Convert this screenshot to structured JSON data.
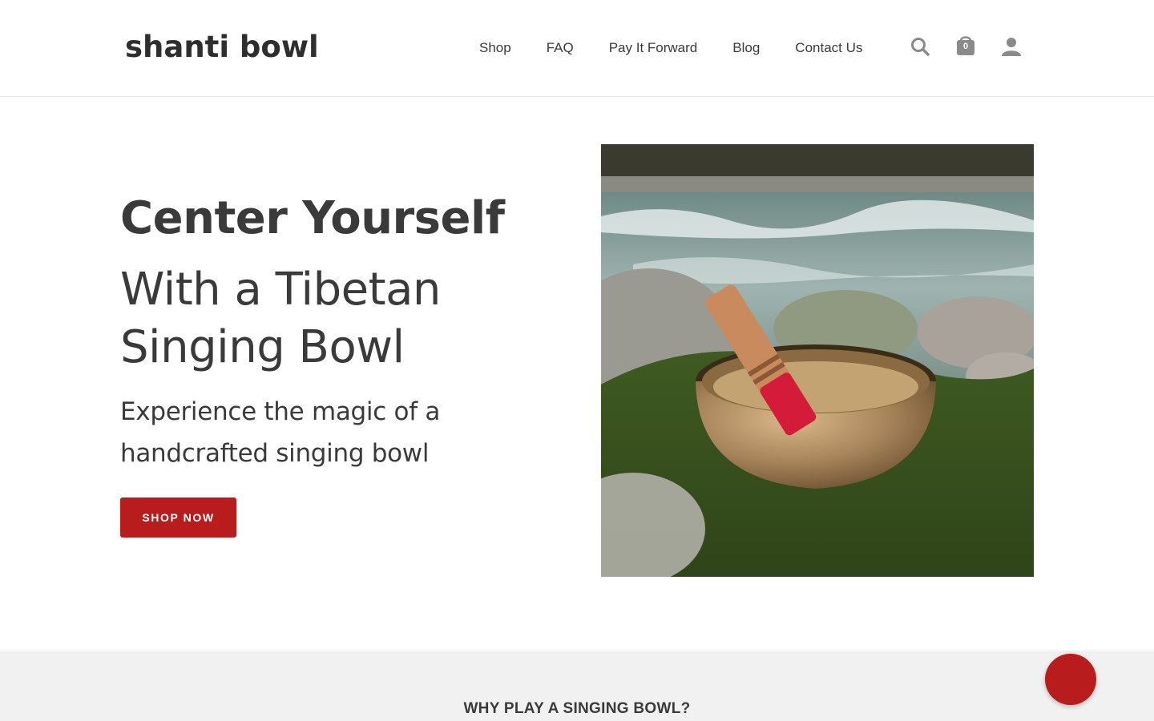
{
  "header": {
    "logo": "shanti bowl",
    "nav": [
      "Shop",
      "FAQ",
      "Pay It Forward",
      "Blog",
      "Contact Us"
    ],
    "cart_count": "0",
    "icons": [
      "search-icon",
      "cart-icon",
      "user-icon"
    ]
  },
  "hero": {
    "title": "Center Yourself",
    "subtitle": "With a Tibetan Singing Bowl",
    "description": "Experience the magic of a handcrafted singing bowl",
    "cta": "SHOP NOW",
    "image_subject": "singing bowl with red mallet on mossy rock by river"
  },
  "section": {
    "title": "WHY PLAY A SINGING BOWL?"
  },
  "colors": {
    "accent": "#b81c1c",
    "text": "#3a3a3a",
    "band": "#f1f1f1"
  }
}
